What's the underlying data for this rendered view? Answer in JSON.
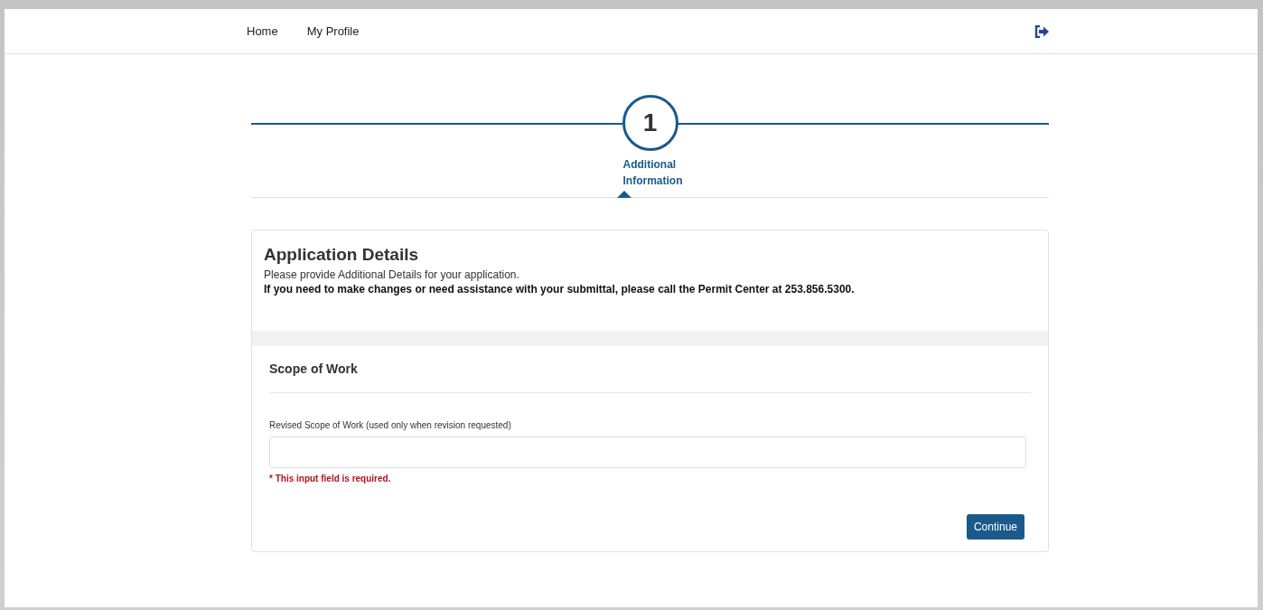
{
  "nav": {
    "links": [
      {
        "label": "Home"
      },
      {
        "label": "My Profile"
      }
    ]
  },
  "steps": [
    {
      "number": "1",
      "label": "Additional Information",
      "selected": true
    }
  ],
  "card": {
    "title": "Application Details",
    "intro": "Please provide Additional Details for your application.",
    "notice": "If you need to make changes or need assistance with your submittal, please call the Permit Center at 253.856.5300.",
    "section": {
      "title": "Scope of Work",
      "field": {
        "label": "Revised Scope of Work (used only when revision requested)",
        "error": "* This input field is required."
      }
    },
    "button": "Continue"
  }
}
